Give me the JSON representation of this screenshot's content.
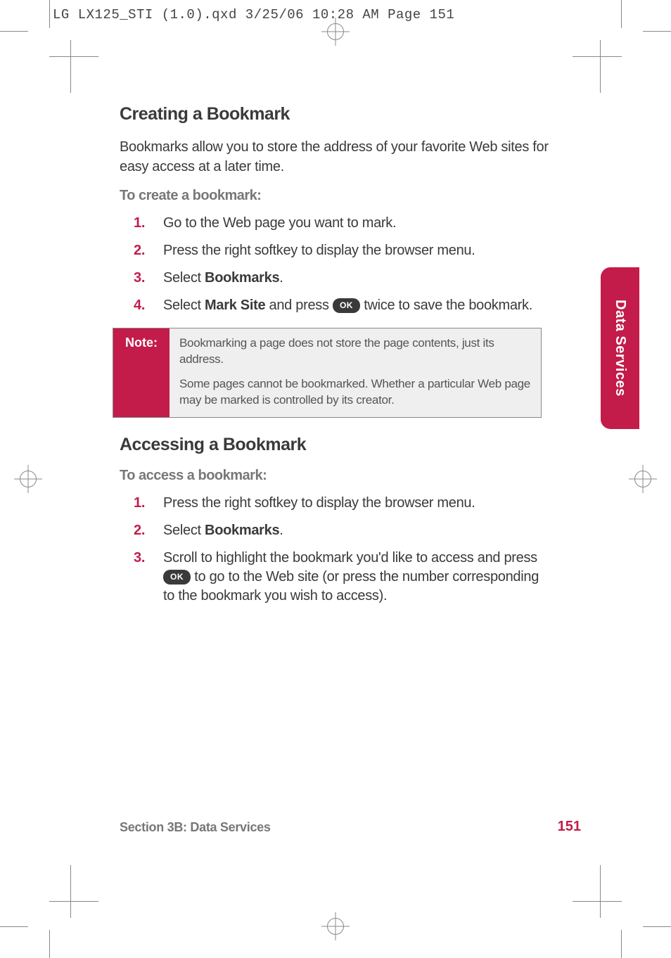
{
  "slug": "LG LX125_STI (1.0).qxd  3/25/06  10:28 AM  Page 151",
  "side_tab": "Data Services",
  "section1": {
    "heading": "Creating a Bookmark",
    "intro": "Bookmarks allow you to store the address of your favorite Web sites for easy access at a later time.",
    "subhead": "To create a bookmark:",
    "steps": {
      "s1": "Go to the Web page you want to mark.",
      "s2": "Press the right softkey to display the browser menu.",
      "s3_a": "Select ",
      "s3_b": "Bookmarks",
      "s3_c": ".",
      "s4_a": "Select ",
      "s4_b": "Mark Site",
      "s4_c": " and press ",
      "s4_d": " twice to save the bookmark."
    }
  },
  "ok_label": "OK",
  "note": {
    "label": "Note:",
    "p1": "Bookmarking a page does not store the page contents, just its address.",
    "p2": "Some pages cannot be bookmarked. Whether a particular Web page may be marked is controlled by its creator."
  },
  "section2": {
    "heading": "Accessing a Bookmark",
    "subhead": "To access a bookmark:",
    "steps": {
      "s1": "Press the right softkey to display the browser menu.",
      "s2_a": "Select ",
      "s2_b": "Bookmarks",
      "s2_c": ".",
      "s3_a": "Scroll to highlight the bookmark you'd like to access and press ",
      "s3_b": " to go to the Web site (or press the number corresponding to the bookmark you wish to access)."
    }
  },
  "footer": {
    "section": "Section 3B: Data Services",
    "page": "151"
  },
  "nums": {
    "n1": "1.",
    "n2": "2.",
    "n3": "3.",
    "n4": "4."
  }
}
